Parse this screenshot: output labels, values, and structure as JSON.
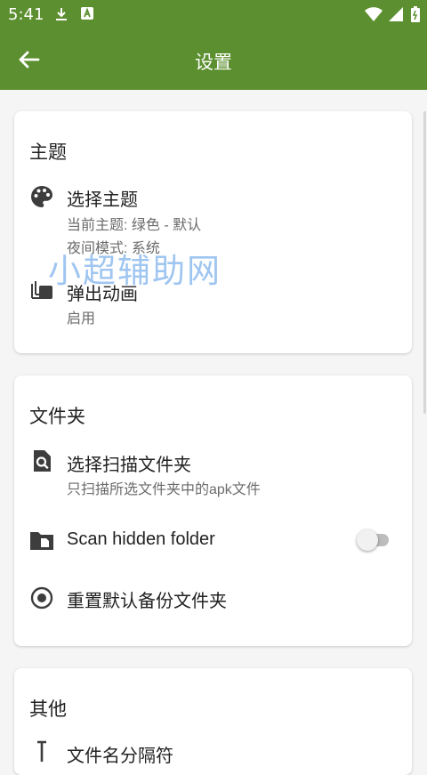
{
  "status_bar": {
    "time": "5:41"
  },
  "app_bar": {
    "title": "设置"
  },
  "sections": {
    "theme": {
      "title": "主题",
      "select_theme": {
        "title": "选择主题",
        "subtitle_line1": "当前主题: 绿色 - 默认",
        "subtitle_line2": "夜间模式: 系统"
      },
      "popup_animation": {
        "title": "弹出动画",
        "subtitle": "启用"
      }
    },
    "folder": {
      "title": "文件夹",
      "select_scan_folder": {
        "title": "选择扫描文件夹",
        "subtitle": "只扫描所选文件夹中的apk文件"
      },
      "scan_hidden": {
        "title": "Scan hidden folder",
        "enabled": false
      },
      "reset_backup": {
        "title": "重置默认备份文件夹"
      }
    },
    "other": {
      "title": "其他",
      "filename_separator": {
        "title": "文件名分隔符"
      }
    }
  },
  "watermark": {
    "text": "小超辅助网"
  },
  "colors": {
    "primary": "#5c8f2f",
    "icon": "#3d3d3d",
    "subtitle": "#6b6b6b",
    "background": "#f5f5f5"
  }
}
